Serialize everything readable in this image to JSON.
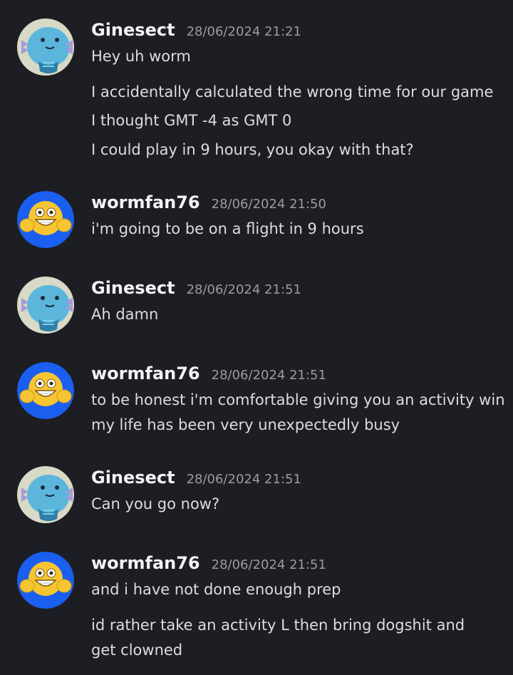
{
  "users": {
    "ginesect": {
      "name": "Ginesect",
      "avatar": "wooper-avatar"
    },
    "wormfan": {
      "name": "wormfan76",
      "avatar": "grinning-emoji-avatar"
    }
  },
  "messages": [
    {
      "author": "Ginesect",
      "timestamp": "28/06/2024 21:21",
      "lines": [
        "Hey uh worm",
        "I accidentally calculated the wrong time for our game",
        "I thought GMT -4 as GMT 0",
        "I could play in 9 hours, you okay with that?"
      ]
    },
    {
      "author": "wormfan76",
      "timestamp": "28/06/2024 21:50",
      "lines": [
        "i'm going to be on a flight in 9 hours"
      ]
    },
    {
      "author": "Ginesect",
      "timestamp": "28/06/2024 21:51",
      "lines": [
        "Ah damn"
      ]
    },
    {
      "author": "wormfan76",
      "timestamp": "28/06/2024 21:51",
      "lines": [
        "to be honest i'm comfortable giving you an activity win",
        "my life has been very unexpectedly busy"
      ]
    },
    {
      "author": "Ginesect",
      "timestamp": "28/06/2024 21:51",
      "lines": [
        "Can you go now?"
      ]
    },
    {
      "author": "wormfan76",
      "timestamp": "28/06/2024 21:51",
      "lines": [
        "and i have not done enough prep",
        "id rather take an activity L then bring dogshit and get clowned"
      ]
    }
  ],
  "colors": {
    "background": "#1d1e23",
    "username": "#f2f3f5",
    "timestamp": "#9a9ca3",
    "text": "#dcdde1",
    "wormfan_avatar_bg": "#1a5ff0",
    "emoji_yellow": "#f7c531"
  }
}
